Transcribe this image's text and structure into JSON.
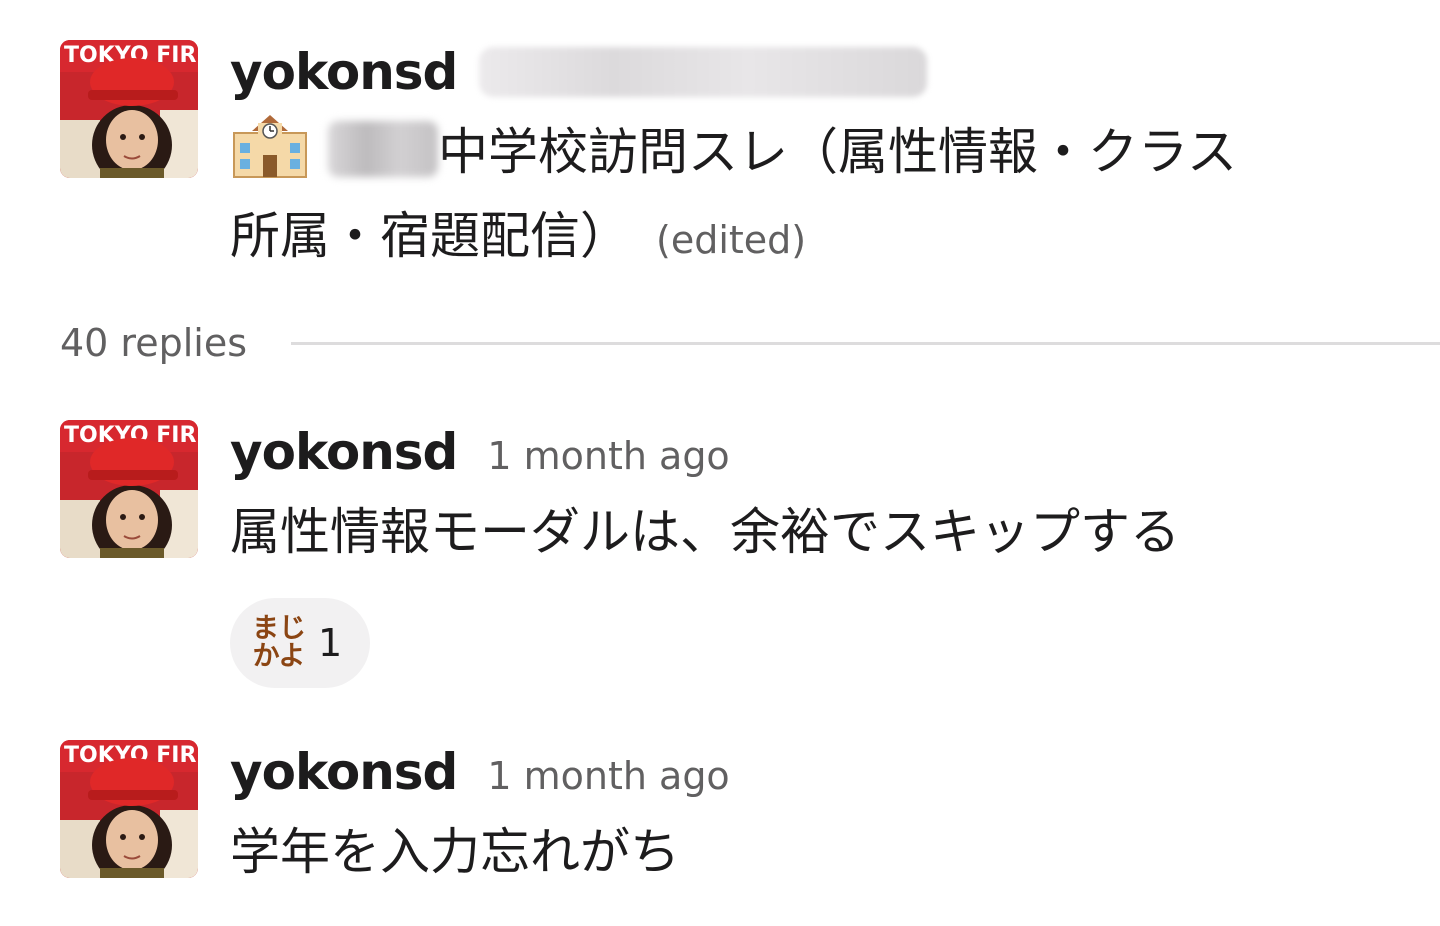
{
  "thread": {
    "parent": {
      "username": "yokonsd",
      "emoji": "school-icon",
      "text_line1": "中学校訪問スレ（属性情報・クラス",
      "text_line2": "所属・宿題配信）",
      "edited_label": "(edited)"
    },
    "replies_label": "40 replies",
    "replies": [
      {
        "username": "yokonsd",
        "timestamp": "1 month ago",
        "text": "属性情報モーダルは、余裕でスキップする",
        "reaction": {
          "emoji_line1": "まじ",
          "emoji_line2": "かよ",
          "count": "1"
        }
      },
      {
        "username": "yokonsd",
        "timestamp": "1 month ago",
        "text": "学年を入力忘れがち"
      }
    ]
  },
  "colors": {
    "text": "#1d1c1d",
    "muted": "#616061",
    "divider": "#dddcdd",
    "reaction_bg": "#f2f1f2",
    "reaction_text": "#8b4513"
  }
}
